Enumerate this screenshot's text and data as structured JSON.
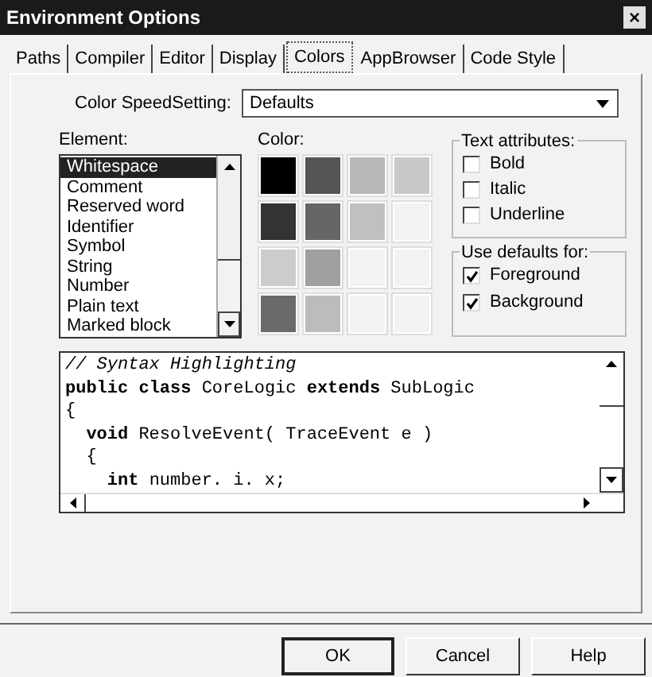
{
  "window": {
    "title": "Environment Options",
    "close": "×"
  },
  "tabs": [
    {
      "label": "Paths",
      "selected": false
    },
    {
      "label": "Compiler",
      "selected": false
    },
    {
      "label": "Editor",
      "selected": false
    },
    {
      "label": "Display",
      "selected": false
    },
    {
      "label": "Colors",
      "selected": true
    },
    {
      "label": "AppBrowser",
      "selected": false
    },
    {
      "label": "Code Style",
      "selected": false
    }
  ],
  "speed_setting": {
    "label": "Color SpeedSetting:",
    "value": "Defaults"
  },
  "element": {
    "label": "Element:",
    "items": [
      {
        "label": "Whitespace",
        "selected": true
      },
      {
        "label": "Comment",
        "selected": false
      },
      {
        "label": "Reserved word",
        "selected": false
      },
      {
        "label": "Identifier",
        "selected": false
      },
      {
        "label": "Symbol",
        "selected": false
      },
      {
        "label": "String",
        "selected": false
      },
      {
        "label": "Number",
        "selected": false
      },
      {
        "label": "Plain text",
        "selected": false
      },
      {
        "label": "Marked block",
        "selected": false
      }
    ]
  },
  "color": {
    "label": "Color:",
    "swatches": [
      {
        "color": "#000000"
      },
      {
        "color": "#555555"
      },
      {
        "color": "#b8b8b8"
      },
      {
        "color": "#c8c8c8"
      },
      {
        "color": "#333333"
      },
      {
        "color": "#666666"
      },
      {
        "color": "#c0c0c0"
      },
      {
        "color": "#f2f2f2"
      },
      {
        "color": "#cccccc"
      },
      {
        "color": "#a0a0a0"
      },
      {
        "color": "#f2f2f2"
      },
      {
        "color": "#f2f2f2"
      },
      {
        "color": "#6a6a6a"
      },
      {
        "color": "#bcbcbc"
      },
      {
        "color": "#f2f2f2"
      },
      {
        "color": "#f2f2f2"
      }
    ]
  },
  "text_attributes": {
    "title": "Text attributes:",
    "options": [
      {
        "label": "Bold",
        "checked": false
      },
      {
        "label": "Italic",
        "checked": false
      },
      {
        "label": "Underline",
        "checked": false
      }
    ]
  },
  "use_defaults": {
    "title": "Use defaults for:",
    "options": [
      {
        "label": "Foreground",
        "checked": true
      },
      {
        "label": "Background",
        "checked": true
      }
    ]
  },
  "preview": {
    "lines": [
      {
        "kind": "comment",
        "text": "// Syntax Highlighting"
      },
      {
        "kind": "code",
        "text": "**public** **class** CoreLogic **extends** SubLogic"
      },
      {
        "kind": "code",
        "text": "{"
      },
      {
        "kind": "code",
        "text": "  **void** ResolveEvent( TraceEvent e )"
      },
      {
        "kind": "code",
        "text": "  {"
      },
      {
        "kind": "code",
        "text": "    **int** number. i. x;"
      }
    ]
  },
  "buttons": [
    {
      "label": "OK",
      "default": true
    },
    {
      "label": "Cancel",
      "default": false
    },
    {
      "label": "Help",
      "default": false
    }
  ]
}
